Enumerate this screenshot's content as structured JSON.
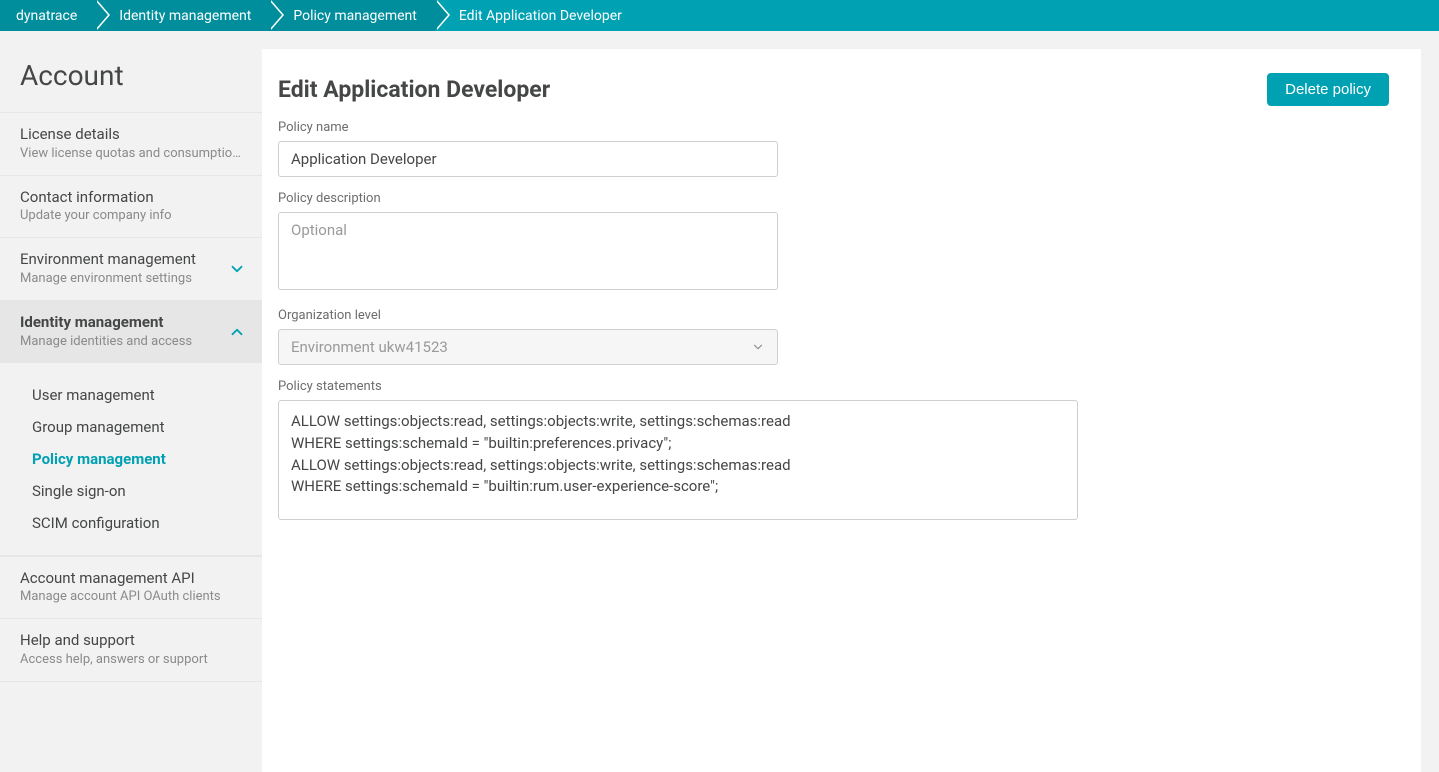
{
  "breadcrumbs": [
    "dynatrace",
    "Identity management",
    "Policy management",
    "Edit Application Developer"
  ],
  "sidebar": {
    "heading": "Account",
    "items": [
      {
        "title": "License details",
        "desc": "View license quotas and consumption de…",
        "expandable": false
      },
      {
        "title": "Contact information",
        "desc": "Update your company info",
        "expandable": false
      },
      {
        "title": "Environment management",
        "desc": "Manage environment settings",
        "expandable": true,
        "expanded": false
      },
      {
        "title": "Identity management",
        "desc": "Manage identities and access",
        "expandable": true,
        "expanded": true,
        "children": [
          {
            "label": "User management",
            "selected": false
          },
          {
            "label": "Group management",
            "selected": false
          },
          {
            "label": "Policy management",
            "selected": true
          },
          {
            "label": "Single sign-on",
            "selected": false
          },
          {
            "label": "SCIM configuration",
            "selected": false
          }
        ]
      },
      {
        "title": "Account management API",
        "desc": "Manage account API OAuth clients",
        "expandable": false
      },
      {
        "title": "Help and support",
        "desc": "Access help, answers or support",
        "expandable": false
      }
    ]
  },
  "page": {
    "title": "Edit Application Developer",
    "delete_label": "Delete policy",
    "fields": {
      "name_label": "Policy name",
      "name_value": "Application Developer",
      "desc_label": "Policy description",
      "desc_placeholder": "Optional",
      "desc_value": "",
      "org_label": "Organization level",
      "org_value": "Environment ukw41523",
      "stmt_label": "Policy statements",
      "stmt_value": "ALLOW settings:objects:read, settings:objects:write, settings:schemas:read\nWHERE settings:schemaId = \"builtin:preferences.privacy\";\nALLOW settings:objects:read, settings:objects:write, settings:schemas:read\nWHERE settings:schemaId = \"builtin:rum.user-experience-score\";"
    }
  },
  "colors": {
    "accent": "#00a1b2"
  }
}
